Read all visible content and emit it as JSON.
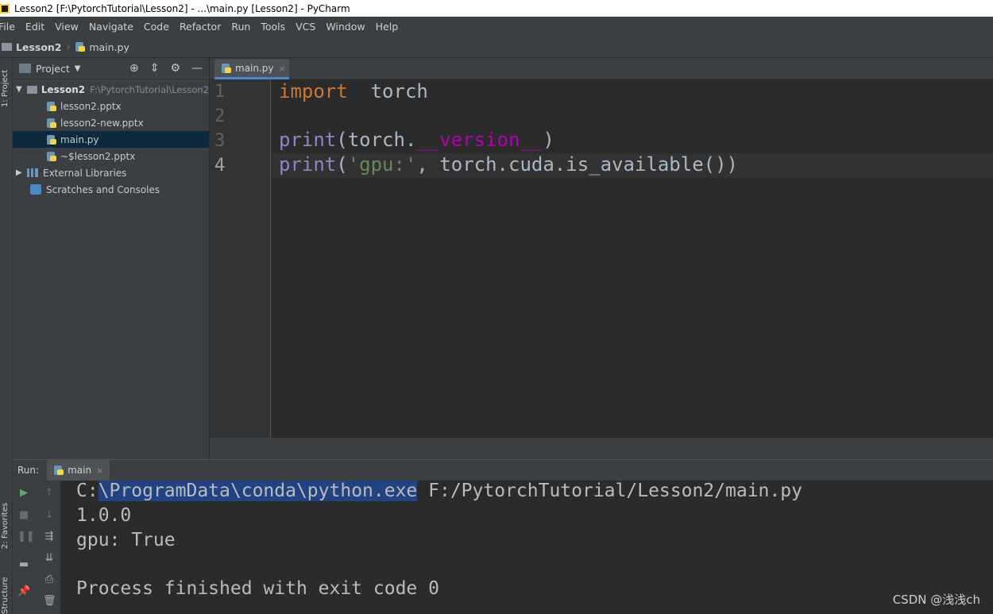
{
  "window": {
    "title": "Lesson2 [F:\\PytorchTutorial\\Lesson2] - ...\\main.py [Lesson2] - PyCharm"
  },
  "menu": [
    "File",
    "Edit",
    "View",
    "Navigate",
    "Code",
    "Refactor",
    "Run",
    "Tools",
    "VCS",
    "Window",
    "Help"
  ],
  "breadcrumb": {
    "project": "Lesson2",
    "file": "main.py"
  },
  "left_strip": {
    "project_tab": "1: Project",
    "favorites_tab": "2: Favorites",
    "structure_tab": "Structure"
  },
  "project_panel": {
    "title": "Project",
    "root": {
      "name": "Lesson2",
      "path": "F:\\PytorchTutorial\\Lesson2"
    },
    "files": [
      "lesson2.pptx",
      "lesson2-new.pptx",
      "main.py",
      "~$lesson2.pptx"
    ],
    "selected_file": "main.py",
    "external_libraries": "External Libraries",
    "scratches": "Scratches and Consoles"
  },
  "editor": {
    "tab": "main.py",
    "line_numbers": [
      "1",
      "2",
      "3",
      "4"
    ],
    "lines": [
      {
        "t1": "import",
        "t2": "  torch"
      },
      {},
      {
        "t1": "print",
        "t2": "(torch.",
        "t3": "__version__",
        "t4": ")"
      },
      {
        "t1": "print",
        "t2": "(",
        "t3": "'gpu:'",
        "t4": ", torch.cuda.is_available())"
      }
    ]
  },
  "run_panel": {
    "label": "Run:",
    "tab": "main",
    "output": {
      "cmd_prefix": "C:",
      "cmd_selected": "\\ProgramData\\conda\\python.exe",
      "cmd_rest": " F:/PytorchTutorial/Lesson2/main.py",
      "version": "1.0.0",
      "gpu": "gpu: True",
      "exit": "Process finished with exit code 0"
    }
  },
  "watermark": "CSDN @浅浅ch",
  "icons": [
    "app-icon",
    "folder-icon",
    "python-file-icon",
    "crosshair-icon",
    "collapse-icon",
    "gear-icon",
    "minimize-icon",
    "run-icon",
    "stop-icon",
    "pause-icon",
    "up-arrow-icon",
    "down-arrow-icon",
    "soft-wrap-icon",
    "scroll-end-icon",
    "print-icon",
    "trash-icon",
    "pin-icon",
    "layout-icon"
  ]
}
